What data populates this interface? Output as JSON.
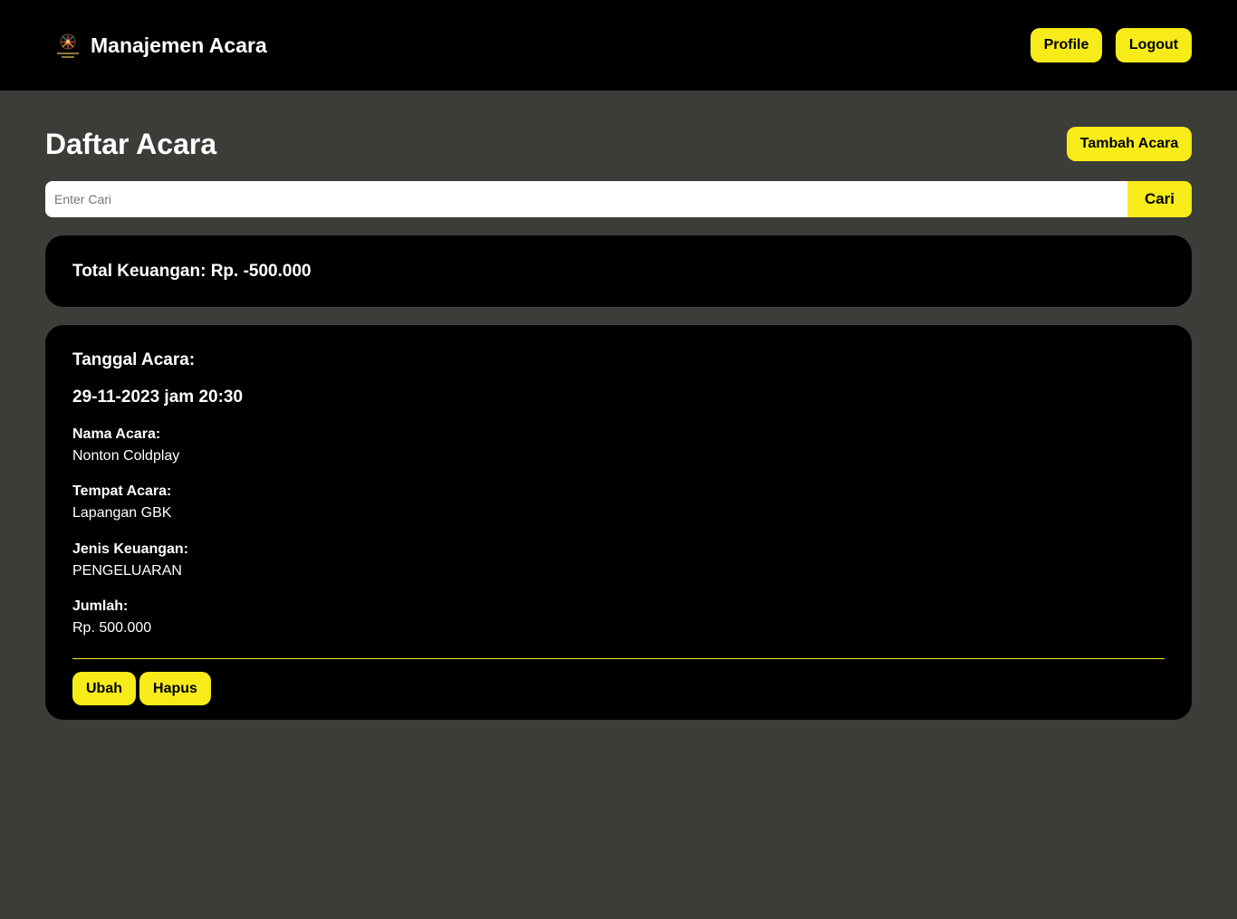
{
  "colors": {
    "accent": "#f7ec19",
    "navbar_bg": "#000000",
    "page_bg": "#3c3d38",
    "card_bg": "#000000"
  },
  "navbar": {
    "logo_icon": "event-management-logo-icon",
    "title": "Manajemen Acara",
    "profile_label": "Profile",
    "logout_label": "Logout"
  },
  "main": {
    "page_title": "Daftar Acara",
    "add_button_label": "Tambah Acara",
    "search": {
      "placeholder": "Enter Cari",
      "value": "",
      "button_label": "Cari"
    },
    "total_text": "Total Keuangan: Rp. -500.000",
    "events": [
      {
        "date_label": "Tanggal Acara:",
        "date_value": "29-11-2023 jam 20:30",
        "name_label": "Nama Acara:",
        "name_value": "Nonton Coldplay",
        "place_label": "Tempat Acara:",
        "place_value": "Lapangan GBK",
        "type_label": "Jenis Keuangan:",
        "type_value": "PENGELUARAN",
        "amount_label": "Jumlah:",
        "amount_value": "Rp. 500.000",
        "edit_label": "Ubah",
        "delete_label": "Hapus"
      }
    ]
  }
}
